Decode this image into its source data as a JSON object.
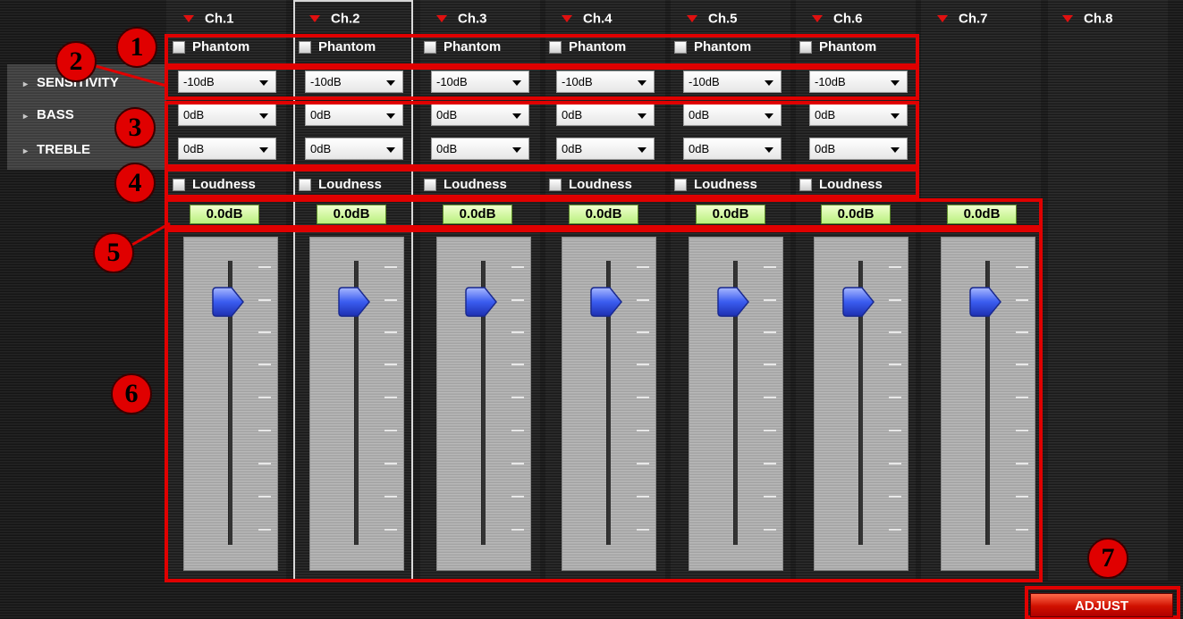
{
  "channels": [
    {
      "label": "Ch.1",
      "phantom": "Phantom",
      "sensitivity": "-10dB",
      "bass": "0dB",
      "treble": "0dB",
      "loudness": "Loudness",
      "level": "0.0dB"
    },
    {
      "label": "Ch.2",
      "phantom": "Phantom",
      "sensitivity": "-10dB",
      "bass": "0dB",
      "treble": "0dB",
      "loudness": "Loudness",
      "level": "0.0dB"
    },
    {
      "label": "Ch.3",
      "phantom": "Phantom",
      "sensitivity": "-10dB",
      "bass": "0dB",
      "treble": "0dB",
      "loudness": "Loudness",
      "level": "0.0dB"
    },
    {
      "label": "Ch.4",
      "phantom": "Phantom",
      "sensitivity": "-10dB",
      "bass": "0dB",
      "treble": "0dB",
      "loudness": "Loudness",
      "level": "0.0dB"
    },
    {
      "label": "Ch.5",
      "phantom": "Phantom",
      "sensitivity": "-10dB",
      "bass": "0dB",
      "treble": "0dB",
      "loudness": "Loudness",
      "level": "0.0dB"
    },
    {
      "label": "Ch.6",
      "phantom": "Phantom",
      "sensitivity": "-10dB",
      "bass": "0dB",
      "treble": "0dB",
      "loudness": "Loudness",
      "level": "0.0dB"
    },
    {
      "label": "Ch.7",
      "level": "0.0dB"
    },
    {
      "label": "Ch.8"
    }
  ],
  "side_menu": {
    "sensitivity": "SENSITIVITY",
    "bass": "BASS",
    "treble": "TREBLE"
  },
  "callouts": [
    "1",
    "2",
    "3",
    "4",
    "5",
    "6",
    "7"
  ],
  "adjust_label": "ADJUST",
  "colors": {
    "annotation_red": "#e00000",
    "level_display": "#b9f07e",
    "knob": "#3a5cf0",
    "triangle": "#e01010"
  }
}
